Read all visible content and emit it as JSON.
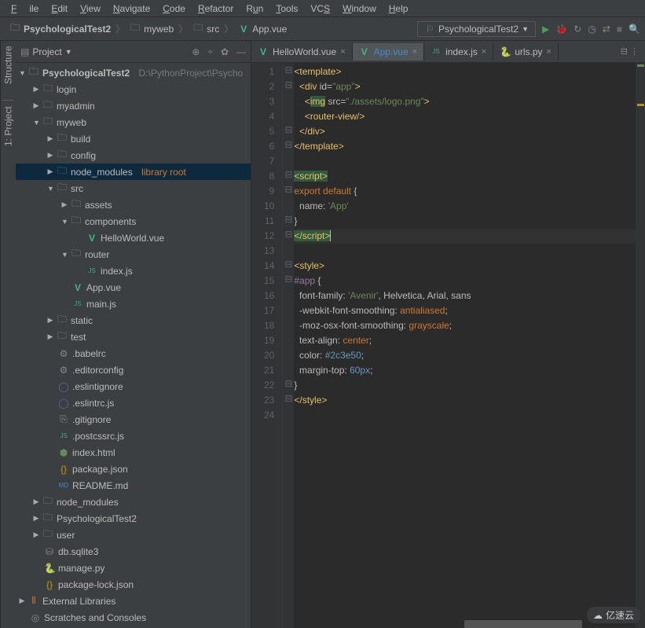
{
  "menu": {
    "file": "File",
    "edit": "Edit",
    "view": "View",
    "navigate": "Navigate",
    "code": "Code",
    "refactor": "Refactor",
    "run": "Run",
    "tools": "Tools",
    "vcs": "VCS",
    "window": "Window",
    "help": "Help"
  },
  "breadcrumbs": {
    "root": "PsychologicalTest2",
    "p1": "myweb",
    "p2": "src",
    "file": "App.vue"
  },
  "run_config": {
    "label": "PsychologicalTest2"
  },
  "sidebar": {
    "title": "Project",
    "left_gutter": {
      "project": "1: Project",
      "structure": "Structure"
    }
  },
  "tree": {
    "rootName": "PsychologicalTest2",
    "rootPath": "D:\\PythonProject\\Psycho",
    "login": "login",
    "myadmin": "myadmin",
    "myweb": "myweb",
    "build": "build",
    "config": "config",
    "node_modules": "node_modules",
    "libroot": "library root",
    "src": "src",
    "assets": "assets",
    "components": "components",
    "hello": "HelloWorld.vue",
    "router": "router",
    "indexjs": "index.js",
    "appvue": "App.vue",
    "mainjs": "main.js",
    "static": "static",
    "test": "test",
    "babelrc": ".babelrc",
    "editorconfig": ".editorconfig",
    "eslintignore": ".eslintignore",
    "eslintrc": ".eslintrc.js",
    "gitignore": ".gitignore",
    "postcss": ".postcssrc.js",
    "indexhtml": "index.html",
    "packagejson": "package.json",
    "readme": "README.md",
    "node_modules2": "node_modules",
    "pt2": "PsychologicalTest2",
    "user": "user",
    "dbsqlite": "db.sqlite3",
    "manage": "manage.py",
    "packagelock": "package-lock.json",
    "extlib": "External Libraries",
    "scratches": "Scratches and Consoles"
  },
  "tabs": {
    "t1": "HelloWorld.vue",
    "t2": "App.vue",
    "t3": "index.js",
    "t4": "urls.py",
    "right": "⊟ ⋮"
  },
  "code": {
    "lines": [
      1,
      2,
      3,
      4,
      5,
      6,
      7,
      8,
      9,
      10,
      11,
      12,
      13,
      14,
      15,
      16,
      17,
      18,
      19,
      20,
      21,
      22,
      23,
      24
    ]
  },
  "watermark": "亿速云"
}
